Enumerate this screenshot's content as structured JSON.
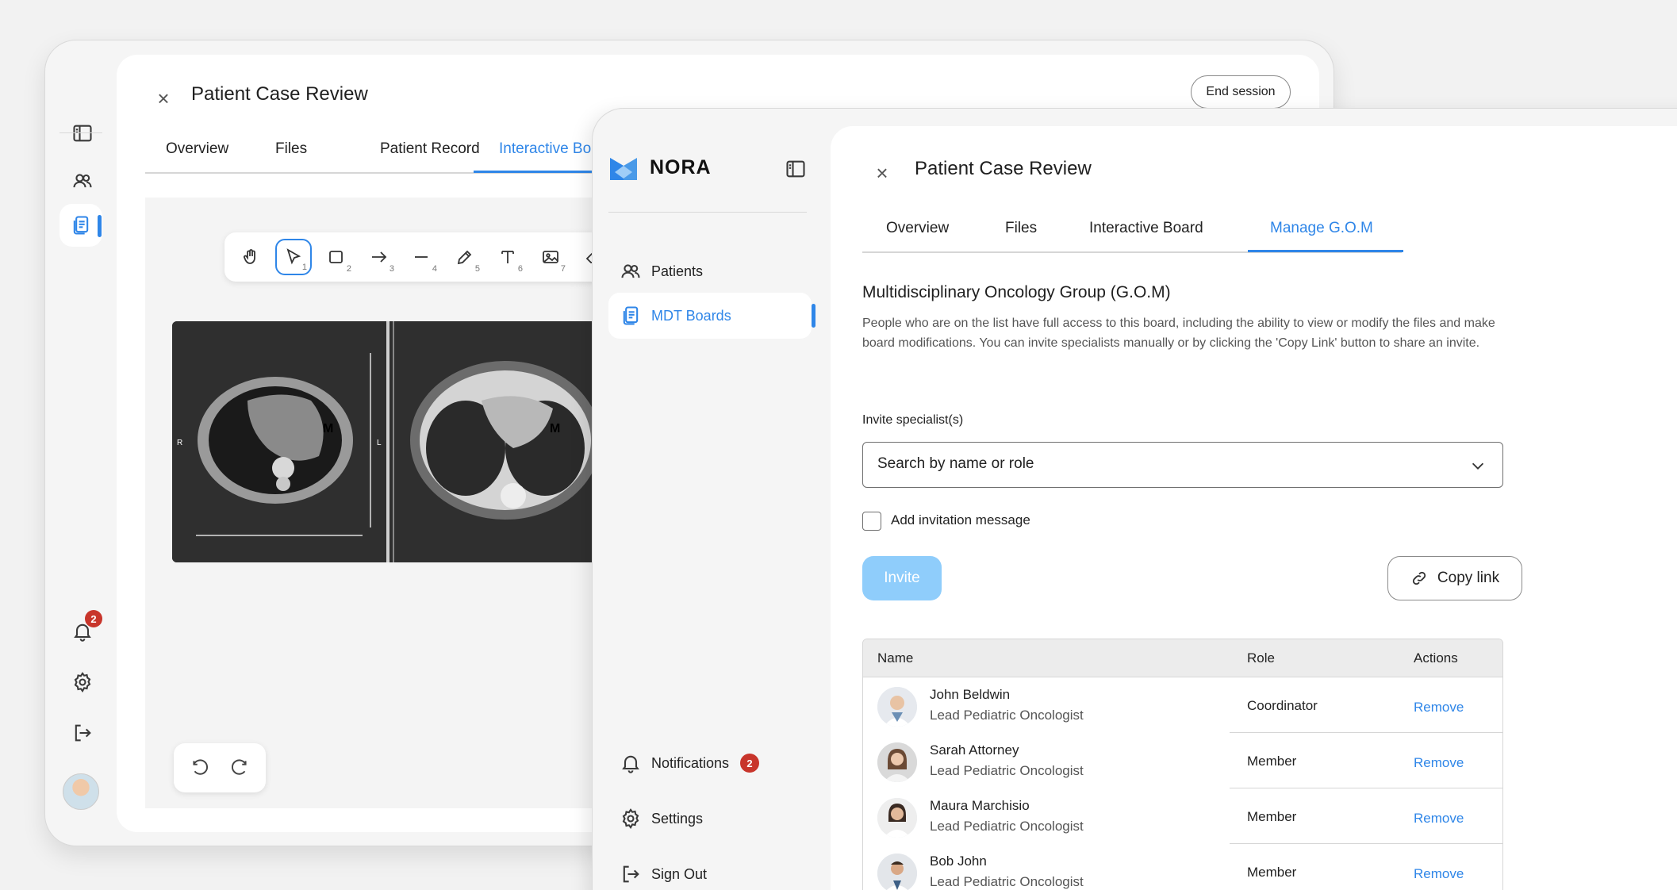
{
  "back_window": {
    "title": "Patient Case Review",
    "end_session_label": "End session",
    "tabs": [
      "Overview",
      "Files",
      "Patient Record",
      "Interactive Bo"
    ],
    "active_tab": "Interactive Bo",
    "tool_numbers": [
      "1",
      "2",
      "3",
      "4",
      "5",
      "6",
      "7"
    ],
    "notification_count": "2",
    "scan_markers": {
      "left": "R",
      "right": "L",
      "mass": "M"
    }
  },
  "sidebar": {
    "brand": "NORA",
    "items": [
      {
        "label": "Patients",
        "icon": "users-icon"
      },
      {
        "label": "MDT Boards",
        "icon": "document-icon"
      }
    ],
    "active_item": "MDT Boards",
    "bottom_items": [
      {
        "label": "Notifications",
        "icon": "bell-icon",
        "badge": "2"
      },
      {
        "label": "Settings",
        "icon": "gear-icon"
      },
      {
        "label": "Sign Out",
        "icon": "sign-out-icon"
      }
    ]
  },
  "main": {
    "title": "Patient Case Review",
    "tabs": [
      "Overview",
      "Files",
      "Interactive Board",
      "Manage G.O.M"
    ],
    "active_tab": "Manage G.O.M",
    "section_title": "Multidisciplinary Oncology Group (G.O.M)",
    "section_desc": "People who are on the list have full access to this board, including the ability to view or modify the files and make board modifications. You can invite specialists manually or by clicking the 'Copy Link' button to share an invite.",
    "invite_label": "Invite specialist(s)",
    "search_placeholder": "Search by name or role",
    "add_message_label": "Add invitation message",
    "invite_button": "Invite",
    "copy_link_button": "Copy link",
    "table": {
      "headers": [
        "Name",
        "Role",
        "Actions"
      ],
      "rows": [
        {
          "name": "John Beldwin",
          "specialty": "Lead Pediatric Oncologist",
          "role": "Coordinator",
          "action": "Remove"
        },
        {
          "name": "Sarah Attorney",
          "specialty": "Lead Pediatric Oncologist",
          "role": "Member",
          "action": "Remove"
        },
        {
          "name": "Maura Marchisio",
          "specialty": "Lead Pediatric Oncologist",
          "role": "Member",
          "action": "Remove"
        },
        {
          "name": "Bob John",
          "specialty": "Lead Pediatric Oncologist",
          "role": "Member",
          "action": "Remove"
        }
      ]
    }
  },
  "colors": {
    "accent": "#2f86e8",
    "badge": "#c8352b",
    "invite_disabled": "#8fcdfb"
  }
}
